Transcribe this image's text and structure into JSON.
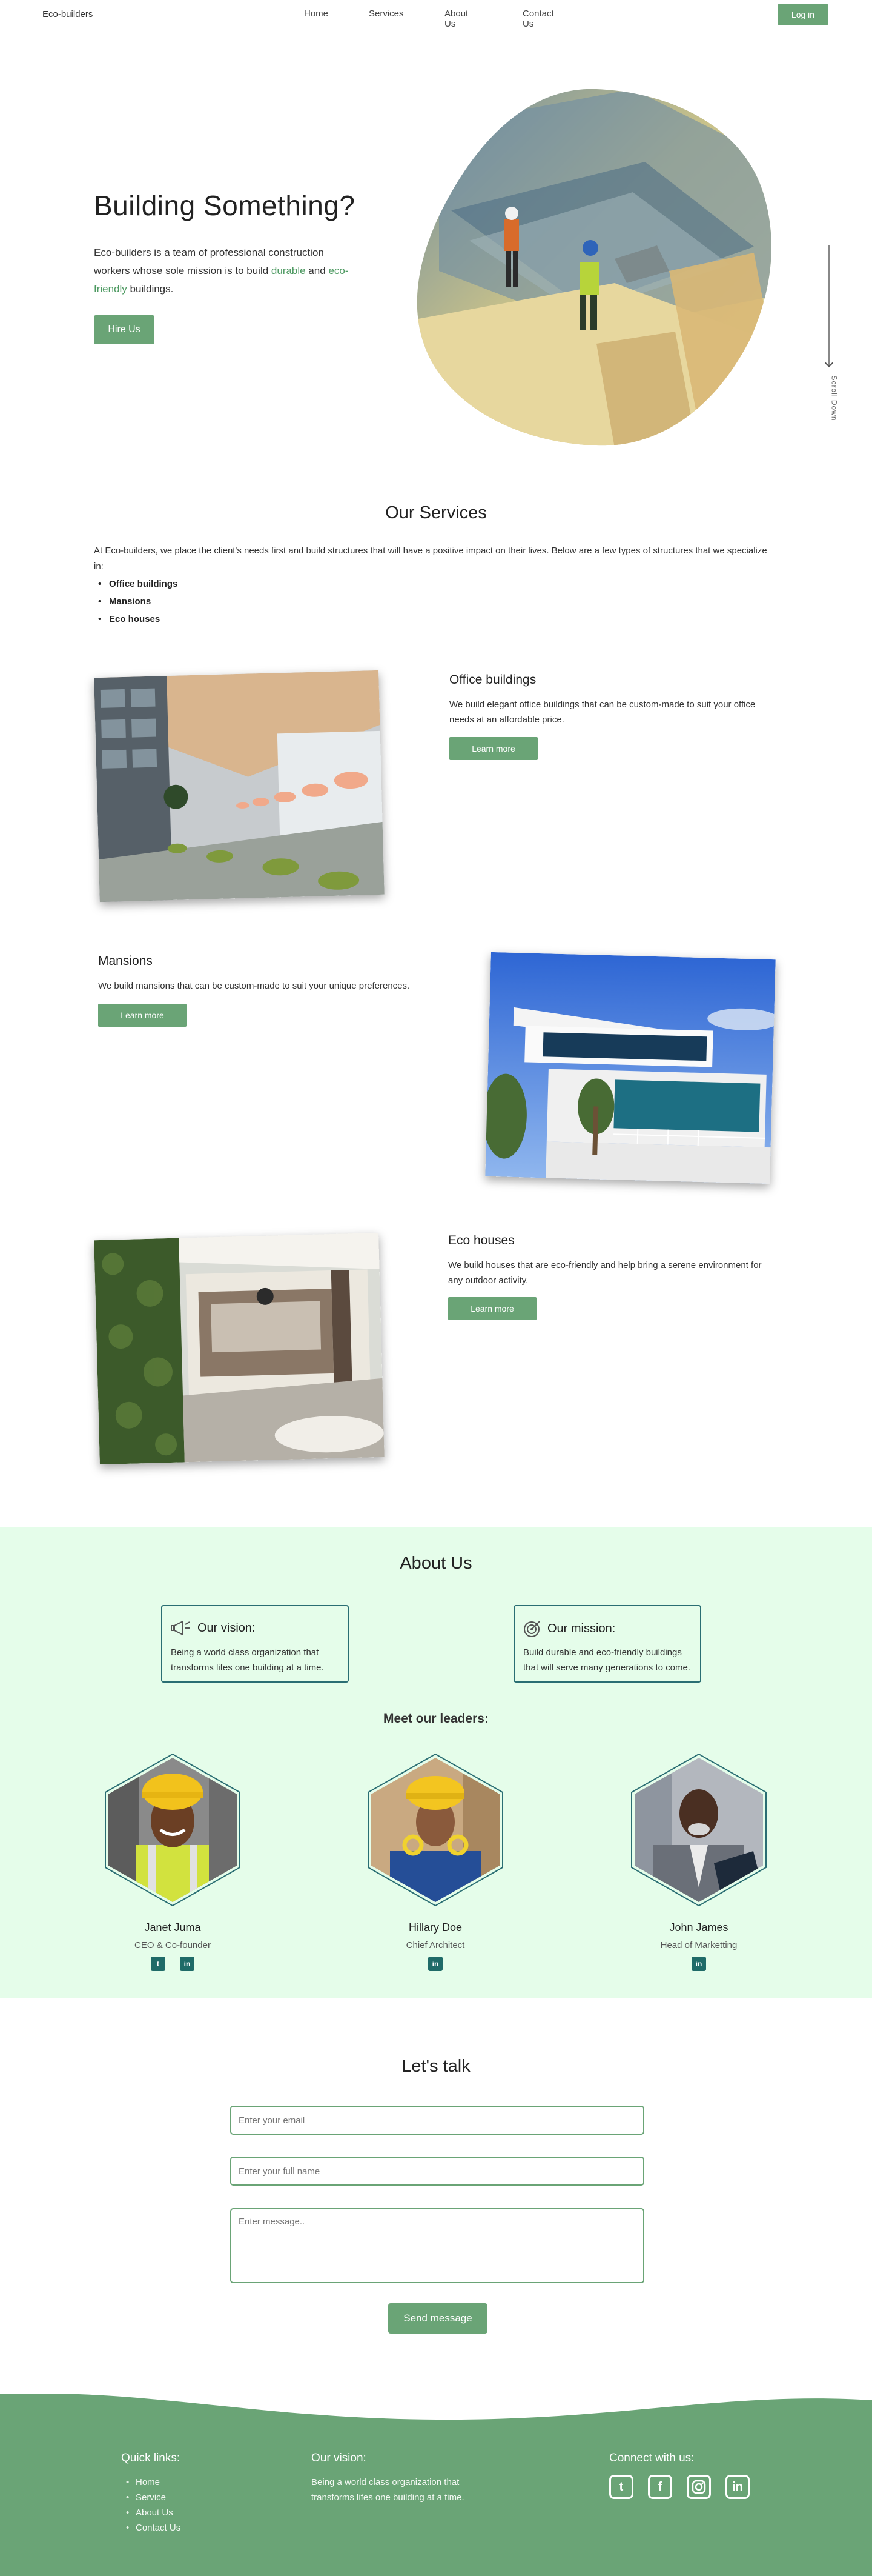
{
  "nav": {
    "brand": "Eco-builders",
    "links": [
      "Home",
      "Services",
      "About Us",
      "Contact Us"
    ],
    "login": "Log in"
  },
  "hero": {
    "title": "Building Something?",
    "text_1": "Eco-builders is a team of professional construction workers whose sole mission is to build ",
    "green_1": "durable",
    "text_2": " and ",
    "green_2": "eco-friendly",
    "text_3": " buildings.",
    "cta": "Hire Us",
    "scroll": "Scroll Down"
  },
  "services": {
    "title": "Our Services",
    "intro": "At Eco-builders, we place the client's needs first and build structures that will have a positive impact on their lives. Below are a few types of structures that we specialize in:",
    "list": [
      "Office buildings",
      "Mansions",
      "Eco houses"
    ],
    "items": [
      {
        "title": "Office buildings",
        "desc": "We build elegant office buildings that can be custom-made to suit your office needs at an affordable price.",
        "button": "Learn more"
      },
      {
        "title": "Mansions",
        "desc": "We build mansions that can be custom-made to suit your unique preferences.",
        "button": "Learn more"
      },
      {
        "title": "Eco houses",
        "desc": "We build houses that are eco-friendly and help bring a serene environment for any outdoor activity.",
        "button": "Learn more"
      }
    ]
  },
  "about": {
    "title": "About Us",
    "vision_title": "Our vision:",
    "vision_text": "Being a world class organization that transforms lifes one building at a time.",
    "mission_title": "Our mission:",
    "mission_text": "Build durable and eco-friendly buildings that will serve many generations to come.",
    "leaders_title": "Meet our leaders:",
    "leaders": [
      {
        "name": "Janet Juma",
        "role": "CEO & Co-founder"
      },
      {
        "name": "Hillary Doe",
        "role": "Chief Architect"
      },
      {
        "name": "John James",
        "role": "Head of Marketting"
      }
    ]
  },
  "contact": {
    "title": "Let's talk",
    "email_placeholder": "Enter your email",
    "name_placeholder": "Enter your full name",
    "message_placeholder": "Enter message..",
    "send": "Send message"
  },
  "footer": {
    "quick_links_title": "Quick links:",
    "quick_links": [
      "Home",
      "Service",
      "About Us",
      "Contact Us"
    ],
    "vision_title": "Our vision:",
    "vision_text": "Being a world class organization that transforms lifes one building at a time.",
    "connect_title": "Connect with us:"
  },
  "colors": {
    "accent": "#6aa476",
    "about_bg": "#e5fdea",
    "card_border": "#2a6e73",
    "social_bg": "#1f6b68"
  },
  "icons": [
    "twitter-icon",
    "linkedin-icon",
    "facebook-icon",
    "instagram-icon",
    "megaphone-icon",
    "target-icon"
  ]
}
